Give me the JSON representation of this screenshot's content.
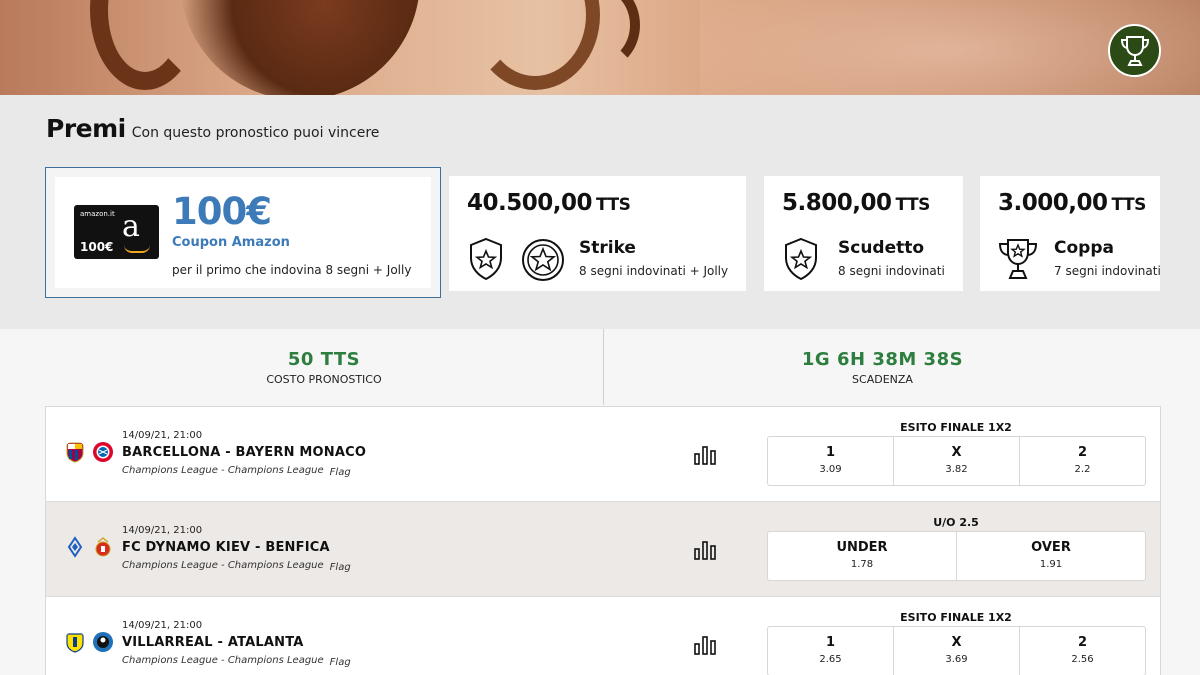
{
  "hero": {
    "trophy_icon": "trophy-icon"
  },
  "premi": {
    "title": "Premi",
    "subtitle": "Con questo pronostico puoi vincere",
    "main": {
      "gift_brand": "amazon.it",
      "gift_amount": "100€",
      "value": "100€",
      "name": "Coupon Amazon",
      "desc": "per il primo che indovina 8 segni + Jolly"
    },
    "prizes": [
      {
        "amount": "40.500,00",
        "unit": "TTS",
        "name": "Strike",
        "desc": "8 segni indovinati + Jolly"
      },
      {
        "amount": "5.800,00",
        "unit": "TTS",
        "name": "Scudetto",
        "desc": "8 segni indovinati"
      },
      {
        "amount": "3.000,00",
        "unit": "TTS",
        "name": "Coppa",
        "desc": "7 segni indovinati"
      }
    ]
  },
  "stats": {
    "cost_value": "50 TTS",
    "cost_label": "COSTO PRONOSTICO",
    "deadline_value": "1G 6H 38M 38S",
    "deadline_label": "SCADENZA"
  },
  "matches": [
    {
      "date": "14/09/21, 21:00",
      "teams": "BARCELLONA - BAYERN MONACO",
      "league": "Champions League - Champions League",
      "flag": "Flag",
      "market": "ESITO FINALE 1X2",
      "odds": [
        {
          "label": "1",
          "value": "3.09"
        },
        {
          "label": "X",
          "value": "3.82"
        },
        {
          "label": "2",
          "value": "2.2"
        }
      ]
    },
    {
      "date": "14/09/21, 21:00",
      "teams": "FC DYNAMO KIEV - BENFICA",
      "league": "Champions League - Champions League",
      "flag": "Flag",
      "market": "U/O 2.5",
      "odds": [
        {
          "label": "UNDER",
          "value": "1.78"
        },
        {
          "label": "OVER",
          "value": "1.91"
        }
      ]
    },
    {
      "date": "14/09/21, 21:00",
      "teams": "VILLARREAL - ATALANTA",
      "league": "Champions League - Champions League",
      "flag": "Flag",
      "market": "ESITO FINALE 1X2",
      "odds": [
        {
          "label": "1",
          "value": "2.65"
        },
        {
          "label": "X",
          "value": "3.69"
        },
        {
          "label": "2",
          "value": "2.56"
        }
      ]
    }
  ],
  "colors": {
    "accent_blue": "#3d7bb8",
    "accent_green": "#2e7f3f",
    "trophy_bg": "#2b4a16"
  }
}
